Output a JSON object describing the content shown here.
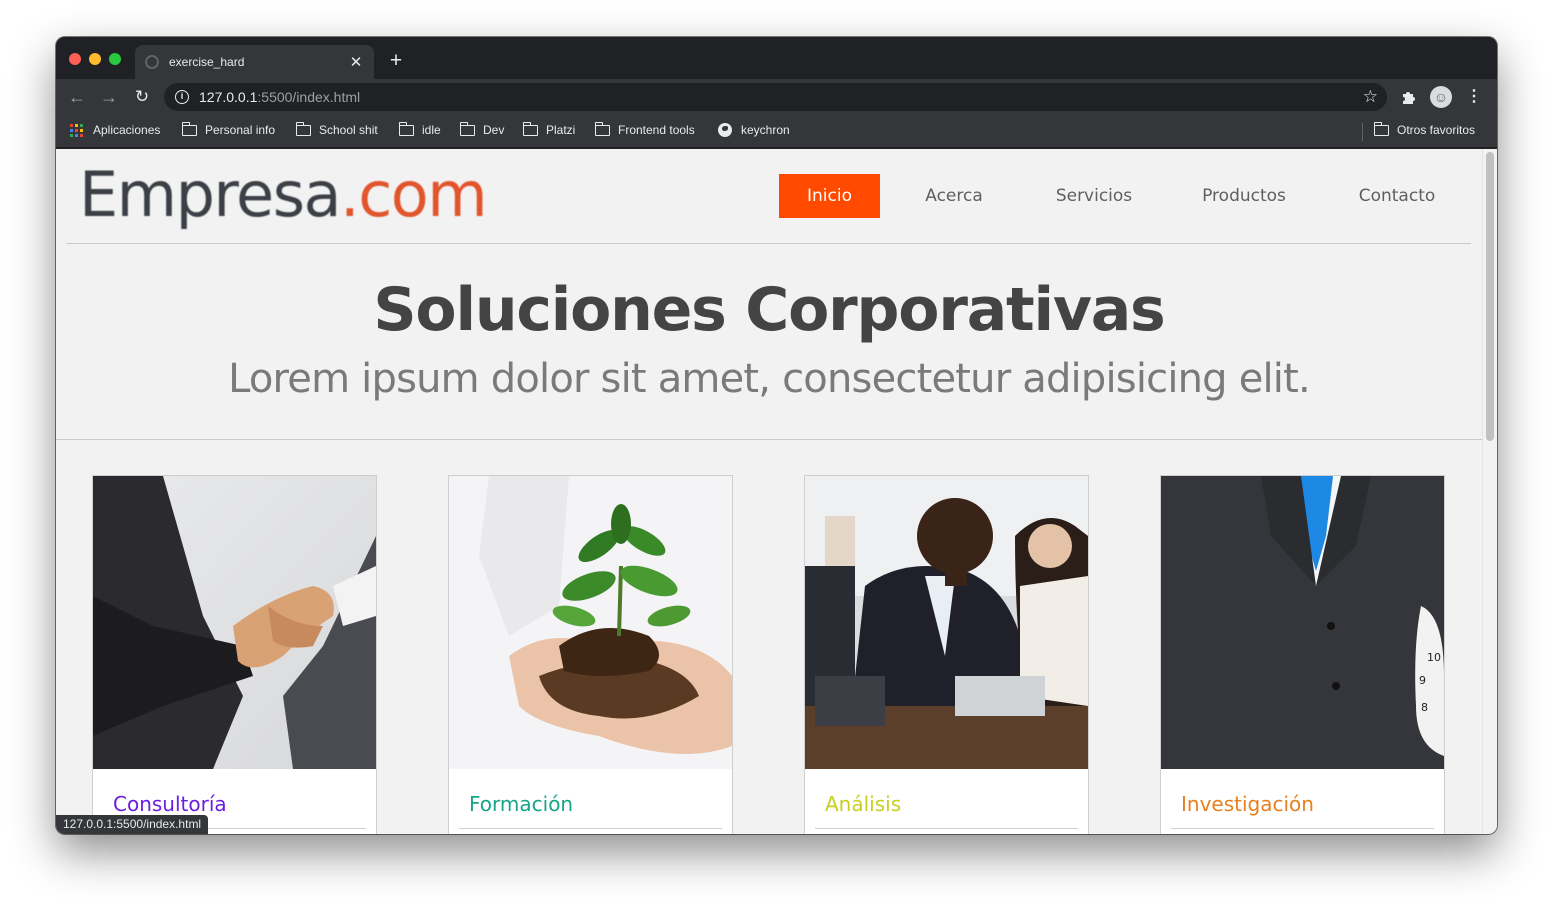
{
  "browser": {
    "tab_title": "exercise_hard",
    "url_host": "127.0.0.1",
    "url_rest": ":5500/index.html",
    "bookmarks": [
      "Aplicaciones",
      "Personal info",
      "School shit",
      "idle",
      "Dev",
      "Platzi",
      "Frontend tools",
      "keychron"
    ],
    "other_bookmarks": "Otros favoritos",
    "status_url": "127.0.0.1:5500/index.html"
  },
  "site": {
    "logo_part1": "Empresa",
    "logo_part2": ".com",
    "nav": [
      "Inicio",
      "Acerca",
      "Servicios",
      "Productos",
      "Contacto"
    ],
    "active_nav": "Inicio",
    "hero_title": "Soluciones Corporativas",
    "hero_subtitle": "Lorem ipsum dolor sit amet, consectetur adipisicing elit.",
    "cards": [
      {
        "title": "Consultoría",
        "image": "handshake-photo",
        "color": "#6a1ee0"
      },
      {
        "title": "Formación",
        "image": "plant-in-hands-photo",
        "color": "#17a58a"
      },
      {
        "title": "Análisis",
        "image": "call-center-photo",
        "color": "#c9cf1c"
      },
      {
        "title": "Investigación",
        "image": "businessman-suit-photo",
        "color": "#e8801e"
      }
    ]
  },
  "colors": {
    "accent": "#ff4a00",
    "page_bg": "#f2f2f2"
  }
}
